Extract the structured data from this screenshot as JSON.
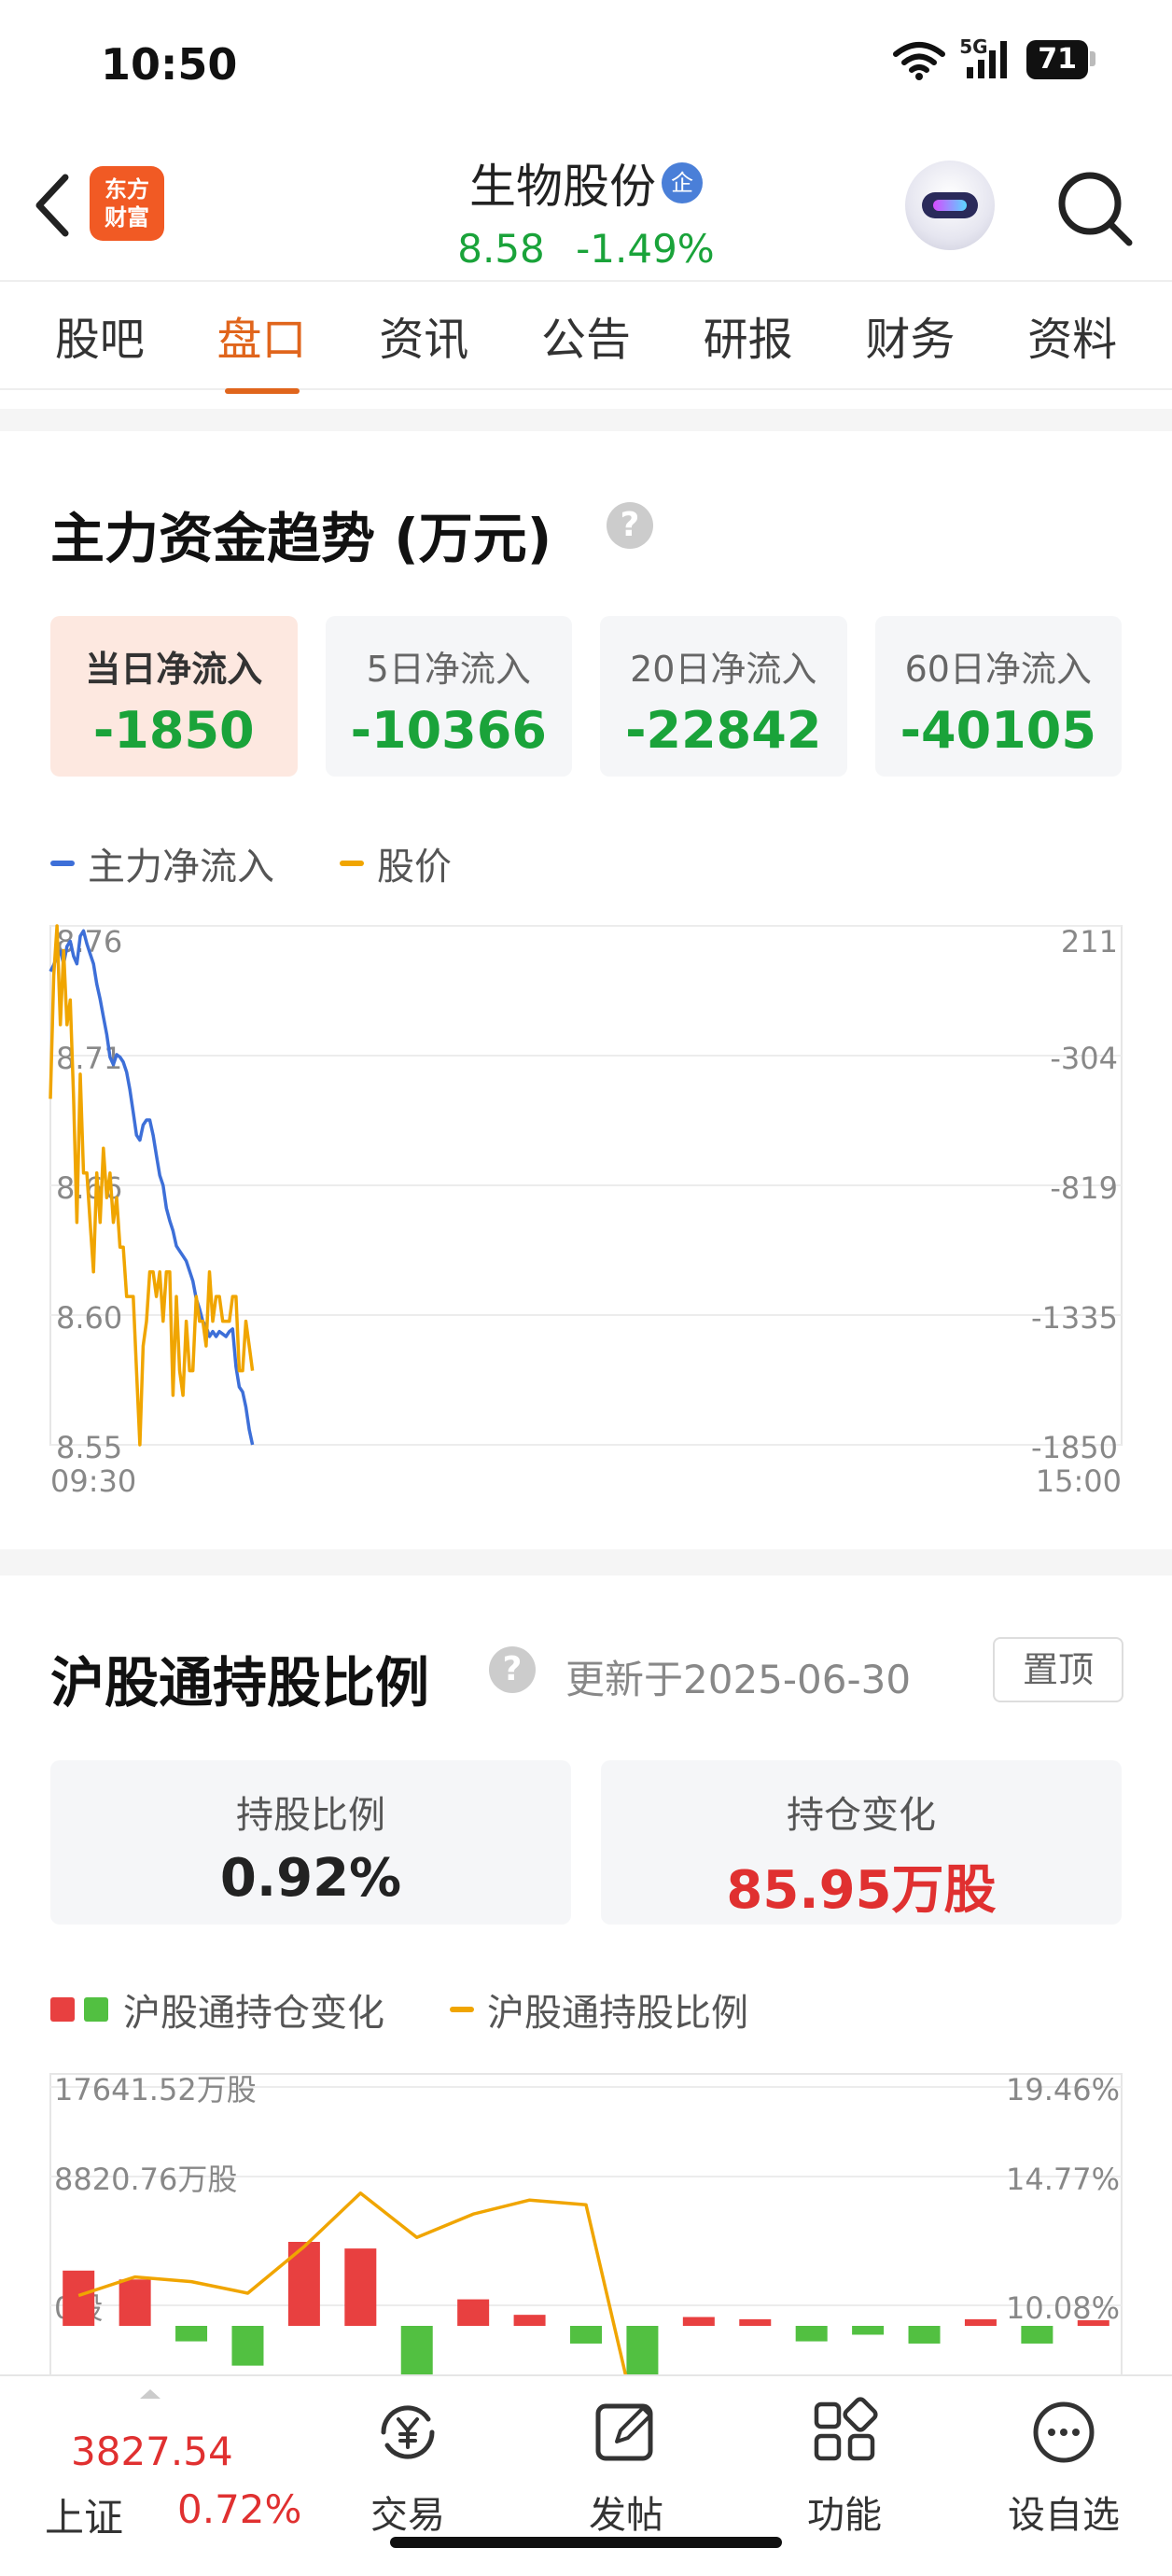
{
  "status_bar": {
    "time": "10:50",
    "network": "5G",
    "battery": "71"
  },
  "header": {
    "app_logo": "东方\n财富",
    "stock_name": "生物股份",
    "badge": "企",
    "price": "8.58",
    "change_pct": "-1.49%"
  },
  "tabs": [
    {
      "label": "股吧",
      "active": false
    },
    {
      "label": "盘口",
      "active": true
    },
    {
      "label": "资讯",
      "active": false
    },
    {
      "label": "公告",
      "active": false
    },
    {
      "label": "研报",
      "active": false
    },
    {
      "label": "财务",
      "active": false
    },
    {
      "label": "资料",
      "active": false
    }
  ],
  "capital_flow": {
    "title": "主力资金趋势 (万元)",
    "help": "?",
    "cards": [
      {
        "label": "当日净流入",
        "value": "-1850",
        "active": true
      },
      {
        "label": "5日净流入",
        "value": "-10366",
        "active": false
      },
      {
        "label": "20日净流入",
        "value": "-22842",
        "active": false
      },
      {
        "label": "60日净流入",
        "value": "-40105",
        "active": false
      }
    ],
    "legend": [
      {
        "name": "主力净流入",
        "color": "#3d6fd8"
      },
      {
        "name": "股价",
        "color": "#f0a500"
      }
    ]
  },
  "hk_connect": {
    "title": "沪股通持股比例",
    "help": "?",
    "updated": "更新于2025-06-30",
    "pin_button": "置顶",
    "cards": [
      {
        "label": "持股比例",
        "value": "0.92%",
        "style": "normal"
      },
      {
        "label": "持仓变化",
        "value": "85.95万股",
        "style": "red"
      }
    ],
    "legend": [
      {
        "name": "沪股通持仓变化",
        "colors": [
          "#e84040",
          "#52c041"
        ]
      },
      {
        "name": "沪股通持股比例",
        "color": "#f0a500"
      }
    ]
  },
  "bottom_bar": {
    "index_value": "3827.54",
    "index_name": "上证",
    "index_change": "0.72%",
    "nav": [
      {
        "label": "交易",
        "icon": "trade-yen-icon"
      },
      {
        "label": "发帖",
        "icon": "compose-icon"
      },
      {
        "label": "功能",
        "icon": "grid-apps-icon"
      },
      {
        "label": "设自选",
        "icon": "more-dots-icon"
      }
    ]
  },
  "chart_data": [
    {
      "type": "line",
      "x_start": "09:30",
      "x_end": "15:00",
      "left_axis_ticks": [
        "8.76",
        "8.71",
        "8.66",
        "8.60",
        "8.55"
      ],
      "right_axis_ticks": [
        "211",
        "-304",
        "-819",
        "-1335",
        "-1850"
      ],
      "ylim_price": [
        8.55,
        8.76
      ],
      "ylim_flow": [
        -1850,
        211
      ],
      "grid": true,
      "series": [
        {
          "name": "主力净流入",
          "color": "#3d6fd8",
          "axis": "right",
          "values": [
            30,
            56,
            90,
            110,
            60,
            130,
            150,
            90,
            60,
            170,
            191,
            140,
            100,
            60,
            -20,
            -80,
            -150,
            -220,
            -310,
            -340,
            -300,
            -310,
            -330,
            -370,
            -440,
            -530,
            -620,
            -640,
            -580,
            -560,
            -560,
            -620,
            -700,
            -780,
            -820,
            -910,
            -960,
            -1000,
            -1060,
            -1080,
            -1100,
            -1120,
            -1160,
            -1200,
            -1270,
            -1310,
            -1360,
            -1380,
            -1420,
            -1400,
            -1420,
            -1400,
            -1410,
            -1420,
            -1400,
            -1390,
            -1540,
            -1620,
            -1640,
            -1700,
            -1790,
            -1850
          ]
        },
        {
          "name": "股价",
          "color": "#f0a500",
          "axis": "left",
          "values": [
            8.69,
            8.74,
            8.76,
            8.72,
            8.75,
            8.72,
            8.73,
            8.69,
            8.64,
            8.7,
            8.66,
            8.66,
            8.64,
            8.62,
            8.66,
            8.64,
            8.67,
            8.65,
            8.66,
            8.64,
            8.65,
            8.63,
            8.63,
            8.61,
            8.61,
            8.61,
            8.58,
            8.55,
            8.59,
            8.6,
            8.62,
            8.62,
            8.61,
            8.62,
            8.6,
            8.62,
            8.62,
            8.57,
            8.61,
            8.58,
            8.57,
            8.6,
            8.58,
            8.58,
            8.61,
            8.6,
            8.6,
            8.59,
            8.62,
            8.6,
            8.61,
            8.61,
            8.6,
            8.6,
            8.6,
            8.61,
            8.61,
            8.58,
            8.58,
            8.6,
            8.59,
            8.58
          ]
        }
      ],
      "x_total_points": 240
    },
    {
      "type": "bar",
      "left_axis_ticks": [
        "17641.52万股",
        "8820.76万股",
        "0股"
      ],
      "right_axis_ticks": [
        "19.46%",
        "14.77%",
        "10.08%"
      ],
      "ylim_left": [
        0,
        17641.52
      ],
      "ylim_right": [
        10.08,
        19.46
      ],
      "grid": true,
      "bars": [
        {
          "name": "沪股通持仓变化",
          "values": [
            2500,
            2100,
            -700,
            -1800,
            3800,
            3500,
            -2500,
            1200,
            500,
            -800,
            -3000,
            400,
            300,
            -700,
            -400,
            -800,
            300,
            -800,
            100
          ]
        }
      ],
      "line": {
        "name": "沪股通持股比例",
        "color": "#f0a500",
        "values": [
          10.5,
          11.3,
          11.1,
          10.6,
          12.6,
          14.9,
          13.0,
          14.0,
          14.6,
          14.4,
          4.0
        ]
      }
    }
  ]
}
